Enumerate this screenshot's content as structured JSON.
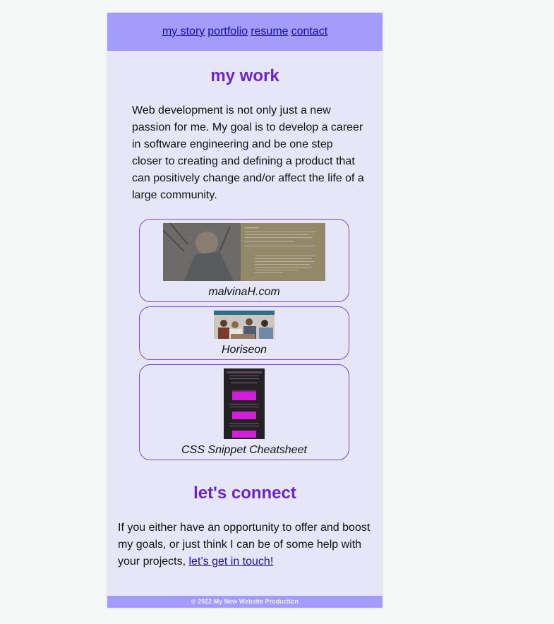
{
  "nav": {
    "links": [
      "my story",
      "portfolio",
      "resume",
      "contact"
    ]
  },
  "work": {
    "title": "my work",
    "intro": "Web development is not only just a new passion for me. My goal is to develop a career in software engineering and be one step closer to creating and defining a product that can positively change and/or affect the life of a large community."
  },
  "portfolio": [
    {
      "caption": "malvinaH.com"
    },
    {
      "caption": "Horiseon"
    },
    {
      "caption": "CSS Snippet Cheatsheet"
    }
  ],
  "connect": {
    "title": "let's connect",
    "text": "If you either have an opportunity to offer and boost my goals, or just think I can be of some help with your projects, ",
    "link": "let’s get in touch!"
  },
  "footer": {
    "text": "© 2022 My New Website Production"
  },
  "colors": {
    "nav_bg": "#a39cfa",
    "page_bg": "#e6e6f8",
    "heading": "#6a26c7",
    "link": "#1a0dab"
  }
}
